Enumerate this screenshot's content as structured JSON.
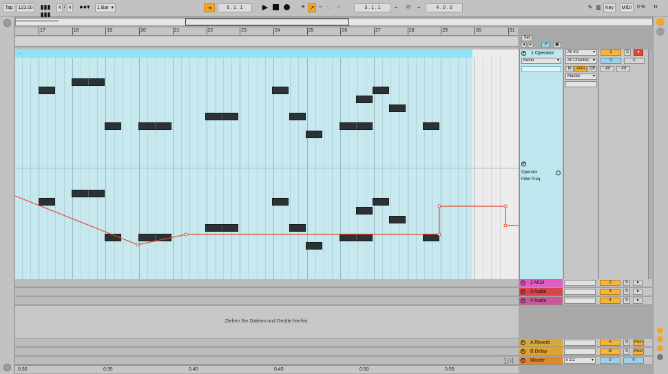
{
  "transport": {
    "tap": "Tap",
    "tempo": "123.00",
    "signature_num": "4",
    "signature_sep": "/",
    "signature_den": "4",
    "quantize": "1 Bar",
    "position": "5 .   1 .   1",
    "loop_start": "3 .   1 .   1",
    "loop_length": "4 .   0 .   0",
    "key": "Key",
    "midi": "MIDI",
    "cpu": "0 %",
    "d": "D"
  },
  "ruler": {
    "bars": [
      "17",
      "18",
      "19",
      "20",
      "21",
      "22",
      "23",
      "24",
      "25",
      "26",
      "27",
      "28",
      "29",
      "30",
      "31"
    ]
  },
  "clip": {
    "name": "..."
  },
  "automation": {
    "device": "Operator",
    "param": "Filter Freq"
  },
  "set_label": "Set",
  "tracks": [
    {
      "num": "1",
      "name": "1 Operator",
      "input": "All Ins",
      "channel": "All Channel",
      "monitor": [
        "In",
        "Auto",
        "Off"
      ],
      "output": "Master",
      "preset": "Keine",
      "vol": "0",
      "pan": "C",
      "meter_l": "-inf",
      "meter_r": "-inf",
      "color": "#bde6ee"
    },
    {
      "num": "2",
      "name": "2 MIDI",
      "color": "#e35ac6"
    },
    {
      "num": "3",
      "name": "3 Audio",
      "color": "#d8444a"
    },
    {
      "num": "4",
      "name": "4 Audio",
      "color": "#c9579a"
    }
  ],
  "returns": [
    {
      "num": "A",
      "name": "A Reverb",
      "color": "#d8a83a",
      "post": "Post"
    },
    {
      "num": "B",
      "name": "B Delay",
      "color": "#e0a231",
      "post": "Post"
    },
    {
      "num": "",
      "name": "Master",
      "color": "#e2862a",
      "quant": "1/2",
      "vol": "0",
      "pan": "0"
    }
  ],
  "solo": "S",
  "dropzone": "Ziehen Sie Dateien und Geräte hierhin.",
  "quantize_grid": "1/4",
  "time_labels": [
    "0:30",
    "0:35",
    "0:40",
    "0:45",
    "0:50",
    "0:55"
  ]
}
